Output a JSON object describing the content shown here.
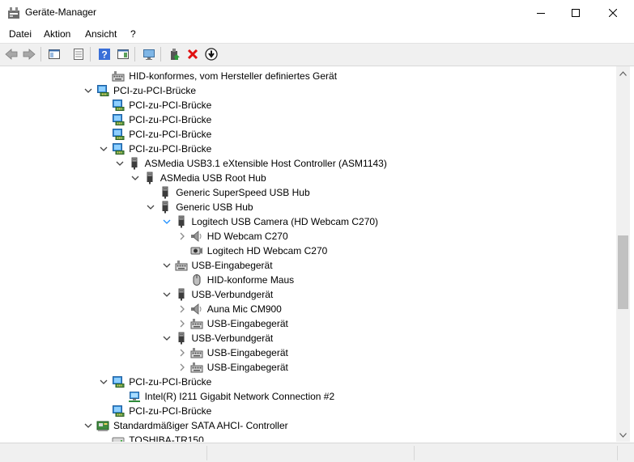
{
  "window": {
    "title": "Geräte-Manager"
  },
  "menu": {
    "items": [
      "Datei",
      "Aktion",
      "Ansicht",
      "?"
    ]
  },
  "toolbar": {
    "buttons": [
      "back-arrow-icon",
      "forward-arrow-icon",
      "show-hide-tree-icon",
      "properties-icon",
      "help-icon",
      "action-pane-icon",
      "monitor-icon",
      "update-driver-icon",
      "uninstall-device-icon",
      "disable-device-icon"
    ]
  },
  "tree": {
    "items": [
      {
        "label": "HID-konformes, vom Hersteller definiertes Gerät",
        "level": 4,
        "expander": "none",
        "icon": "hid-icon"
      },
      {
        "label": "PCI-zu-PCI-Brücke",
        "level": 3,
        "expander": "expanded",
        "icon": "pci-bridge-icon"
      },
      {
        "label": "PCI-zu-PCI-Brücke",
        "level": 4,
        "expander": "none",
        "icon": "pci-bridge-icon"
      },
      {
        "label": "PCI-zu-PCI-Brücke",
        "level": 4,
        "expander": "none",
        "icon": "pci-bridge-icon"
      },
      {
        "label": "PCI-zu-PCI-Brücke",
        "level": 4,
        "expander": "none",
        "icon": "pci-bridge-icon"
      },
      {
        "label": "PCI-zu-PCI-Brücke",
        "level": 4,
        "expander": "expanded",
        "icon": "pci-bridge-icon"
      },
      {
        "label": "ASMedia USB3.1 eXtensible Host Controller (ASM1143)",
        "level": 5,
        "expander": "expanded",
        "icon": "usb-icon"
      },
      {
        "label": "ASMedia USB Root Hub",
        "level": 6,
        "expander": "expanded",
        "icon": "usb-icon"
      },
      {
        "label": "Generic SuperSpeed USB Hub",
        "level": 7,
        "expander": "none",
        "icon": "usb-icon"
      },
      {
        "label": "Generic USB Hub",
        "level": 7,
        "expander": "expanded",
        "icon": "usb-icon"
      },
      {
        "label": "Logitech USB Camera (HD Webcam C270)",
        "level": 8,
        "expander": "expanded-hover",
        "icon": "usb-icon"
      },
      {
        "label": "HD Webcam C270",
        "level": 9,
        "expander": "collapsed",
        "icon": "speaker-icon"
      },
      {
        "label": "Logitech HD Webcam C270",
        "level": 9,
        "expander": "none",
        "icon": "camera-icon"
      },
      {
        "label": "USB-Eingabegerät",
        "level": 8,
        "expander": "expanded",
        "icon": "hid-icon"
      },
      {
        "label": "HID-konforme Maus",
        "level": 9,
        "expander": "none",
        "icon": "mouse-icon"
      },
      {
        "label": "USB-Verbundgerät",
        "level": 8,
        "expander": "expanded",
        "icon": "usb-icon"
      },
      {
        "label": "Auna Mic CM900",
        "level": 9,
        "expander": "collapsed",
        "icon": "speaker-icon"
      },
      {
        "label": "USB-Eingabegerät",
        "level": 9,
        "expander": "collapsed",
        "icon": "hid-icon"
      },
      {
        "label": "USB-Verbundgerät",
        "level": 8,
        "expander": "expanded",
        "icon": "usb-icon"
      },
      {
        "label": "USB-Eingabegerät",
        "level": 9,
        "expander": "collapsed",
        "icon": "hid-icon"
      },
      {
        "label": "USB-Eingabegerät",
        "level": 9,
        "expander": "collapsed",
        "icon": "hid-icon"
      },
      {
        "label": "PCI-zu-PCI-Brücke",
        "level": 4,
        "expander": "expanded",
        "icon": "pci-bridge-icon"
      },
      {
        "label": "Intel(R) I211 Gigabit Network Connection #2",
        "level": 5,
        "expander": "none",
        "icon": "network-icon"
      },
      {
        "label": "PCI-zu-PCI-Brücke",
        "level": 4,
        "expander": "none",
        "icon": "pci-bridge-icon"
      },
      {
        "label": "Standardmäßiger SATA AHCI- Controller",
        "level": 3,
        "expander": "expanded",
        "icon": "storage-controller-icon"
      },
      {
        "label": "TOSHIBA-TR150",
        "level": 4,
        "expander": "none",
        "icon": "disk-icon"
      }
    ]
  },
  "colors": {
    "accent": "#0078d7",
    "hover_expander": "#1e90ff",
    "close_red": "#e81123"
  }
}
